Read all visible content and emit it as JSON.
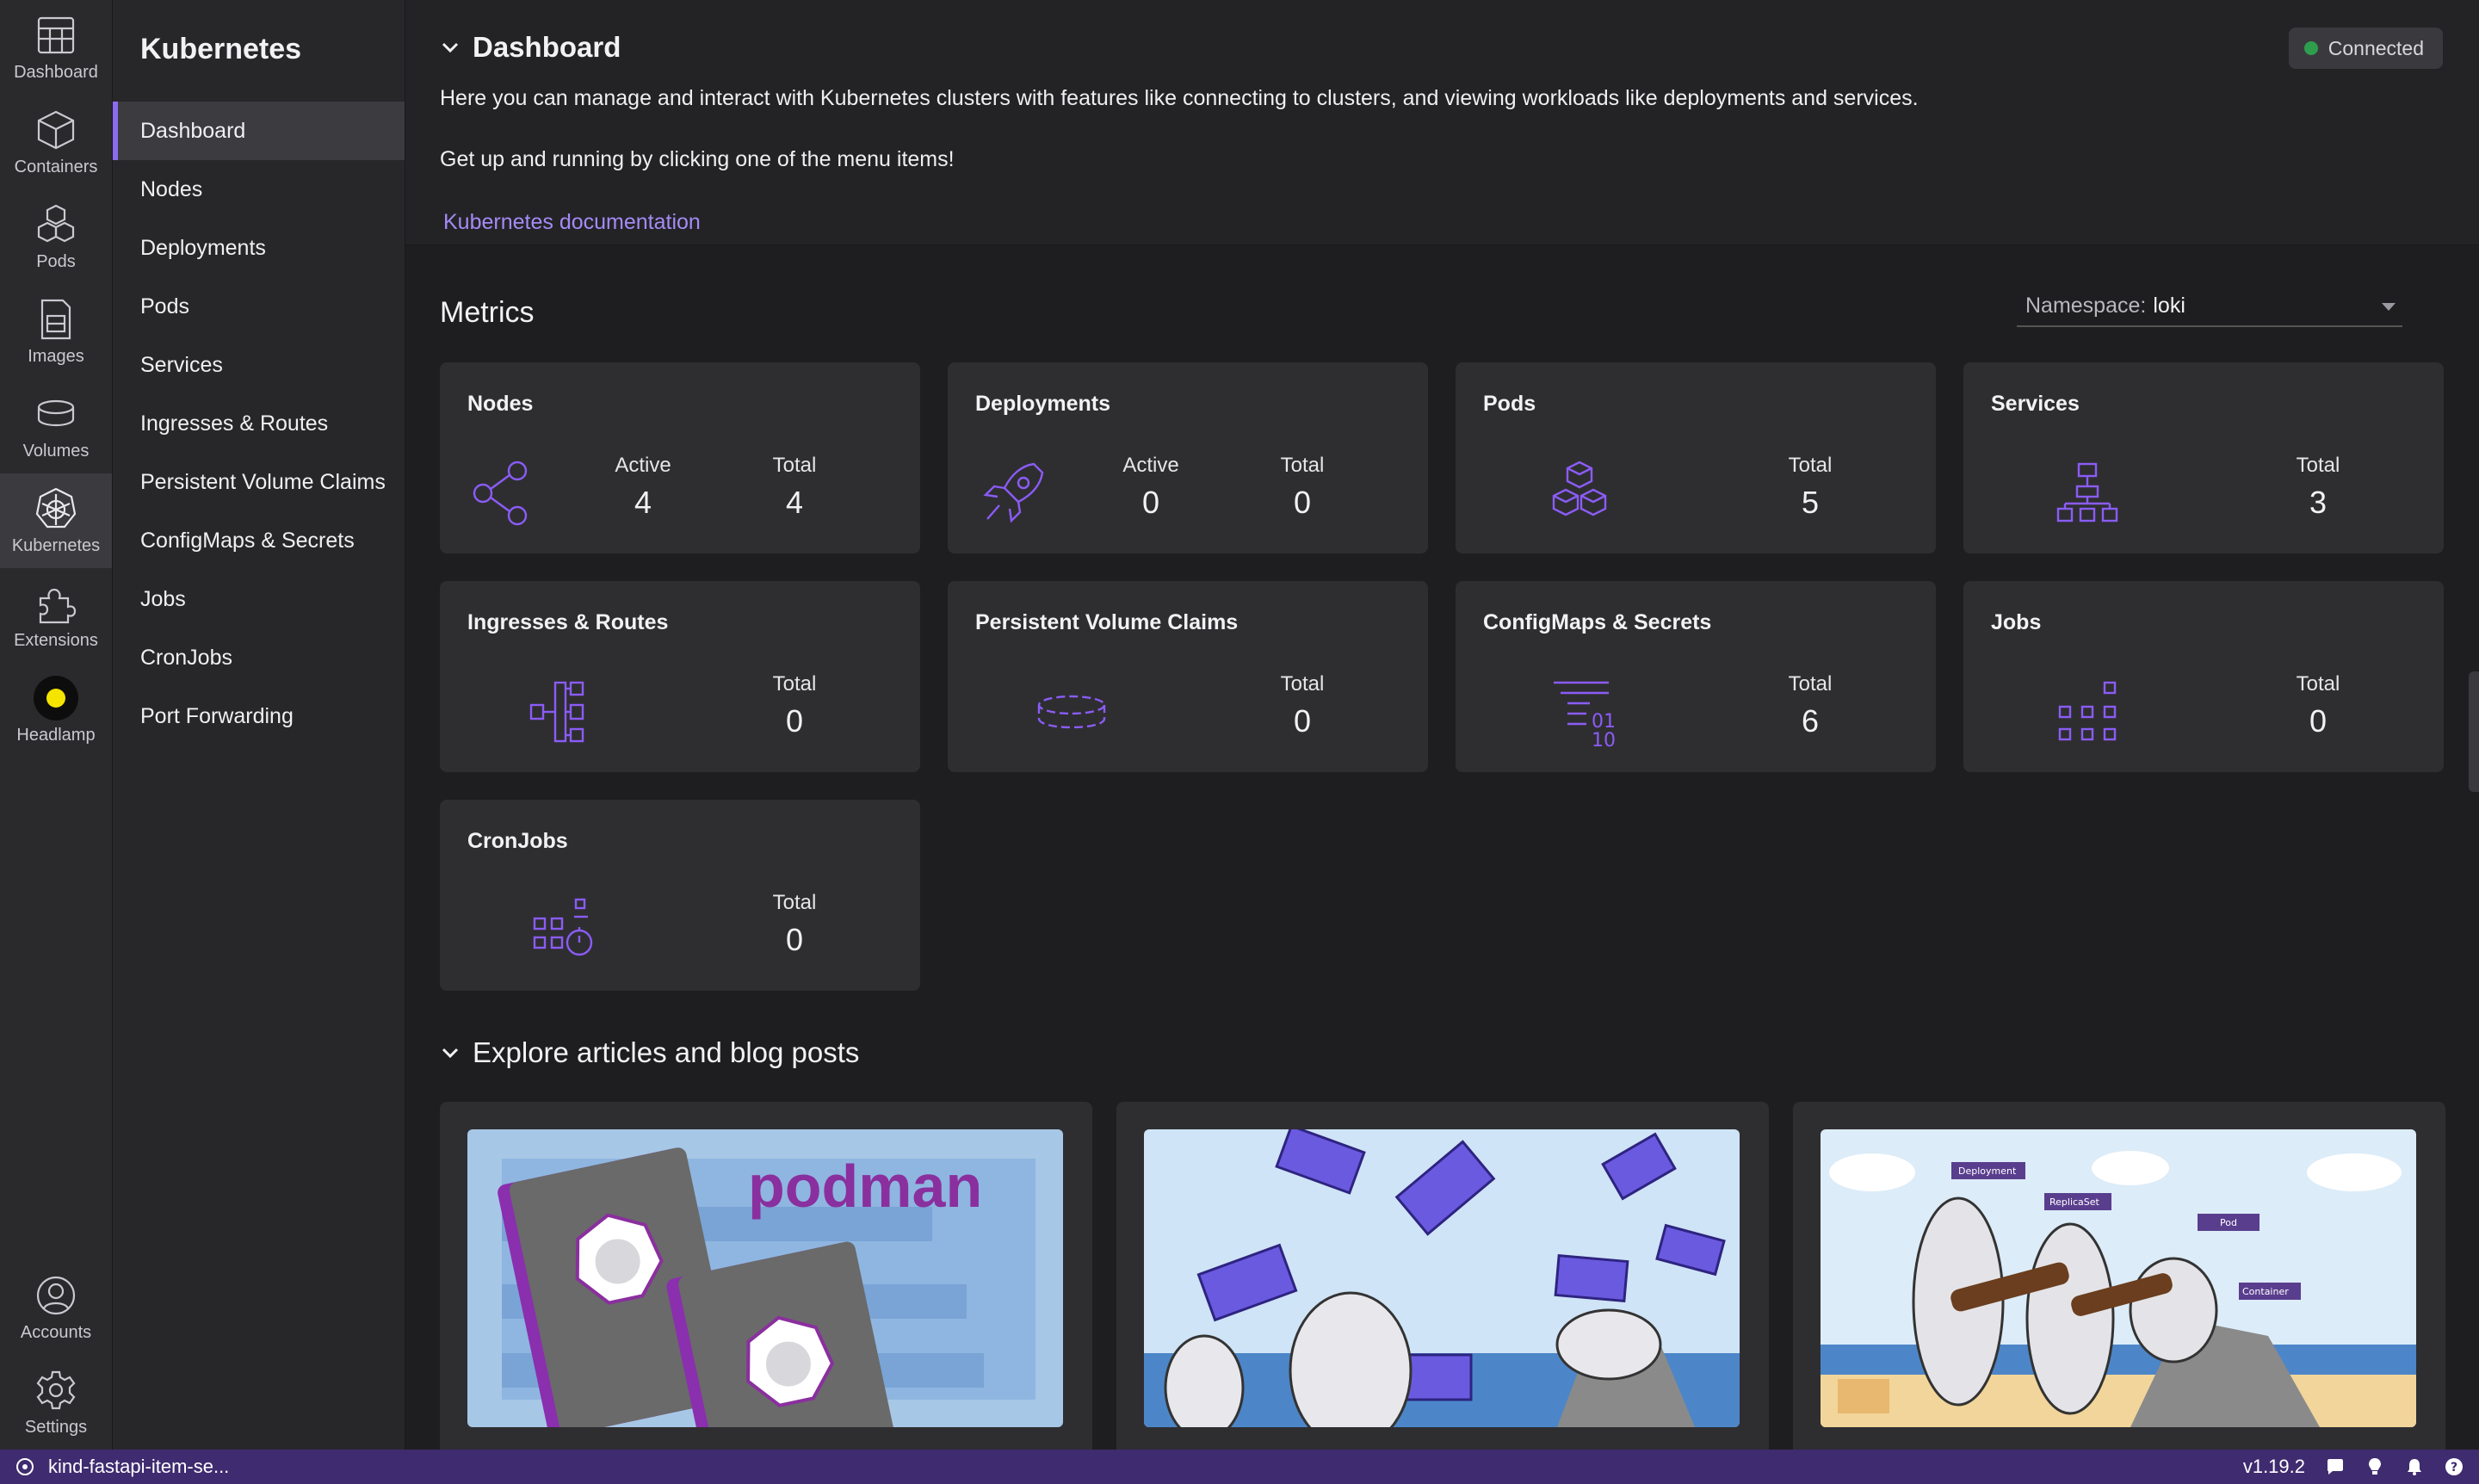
{
  "nav": {
    "items": [
      {
        "label": "Dashboard",
        "icon": "dashboard-icon"
      },
      {
        "label": "Containers",
        "icon": "container-icon"
      },
      {
        "label": "Pods",
        "icon": "pods-icon"
      },
      {
        "label": "Images",
        "icon": "image-icon"
      },
      {
        "label": "Volumes",
        "icon": "volume-icon"
      },
      {
        "label": "Kubernetes",
        "icon": "kubernetes-icon"
      },
      {
        "label": "Extensions",
        "icon": "puzzle-icon"
      },
      {
        "label": "Headlamp",
        "icon": "headlamp-icon"
      }
    ],
    "bottom": [
      {
        "label": "Accounts",
        "icon": "user-icon"
      },
      {
        "label": "Settings",
        "icon": "gear-icon"
      }
    ]
  },
  "side": {
    "title": "Kubernetes",
    "items": [
      "Dashboard",
      "Nodes",
      "Deployments",
      "Pods",
      "Services",
      "Ingresses & Routes",
      "Persistent Volume Claims",
      "ConfigMaps & Secrets",
      "Jobs",
      "CronJobs",
      "Port Forwarding"
    ]
  },
  "hero": {
    "title": "Dashboard",
    "line1": "Here you can manage and interact with Kubernetes clusters with features like connecting to clusters, and viewing workloads like deployments and services.",
    "line2": "Get up and running by clicking one of the menu items!",
    "link": "Kubernetes documentation",
    "status": "Connected"
  },
  "metrics": {
    "title": "Metrics",
    "namespace_label": "Namespace:",
    "namespace_value": "loki",
    "cards": [
      {
        "title": "Nodes",
        "stats": [
          {
            "label": "Active",
            "value": "4"
          },
          {
            "label": "Total",
            "value": "4"
          }
        ],
        "icon": "nodes-icon"
      },
      {
        "title": "Deployments",
        "stats": [
          {
            "label": "Active",
            "value": "0"
          },
          {
            "label": "Total",
            "value": "0"
          }
        ],
        "icon": "rocket-icon"
      },
      {
        "title": "Pods",
        "stats": [
          {
            "label": "Total",
            "value": "5"
          }
        ],
        "icon": "cubes-icon"
      },
      {
        "title": "Services",
        "stats": [
          {
            "label": "Total",
            "value": "3"
          }
        ],
        "icon": "hierarchy-icon"
      },
      {
        "title": "Ingresses & Routes",
        "stats": [
          {
            "label": "Total",
            "value": "0"
          }
        ],
        "icon": "routes-icon"
      },
      {
        "title": "Persistent Volume Claims",
        "stats": [
          {
            "label": "Total",
            "value": "0"
          }
        ],
        "icon": "disk-icon"
      },
      {
        "title": "ConfigMaps & Secrets",
        "stats": [
          {
            "label": "Total",
            "value": "6"
          }
        ],
        "icon": "binary-icon"
      },
      {
        "title": "Jobs",
        "stats": [
          {
            "label": "Total",
            "value": "0"
          }
        ],
        "icon": "grid-icon"
      },
      {
        "title": "CronJobs",
        "stats": [
          {
            "label": "Total",
            "value": "0"
          }
        ],
        "icon": "timer-icon"
      }
    ]
  },
  "explore": {
    "title": "Explore articles and blog posts",
    "card1_word": "podman",
    "card3_labels": [
      "Deployment",
      "ReplicaSet",
      "Pod",
      "Container"
    ]
  },
  "status": {
    "context": "kind-fastapi-item-se...",
    "version": "v1.19.2"
  },
  "colors": {
    "accent": "#8b5cf6",
    "statusbar": "#3f2b6f",
    "connected": "#2e9e4e"
  }
}
